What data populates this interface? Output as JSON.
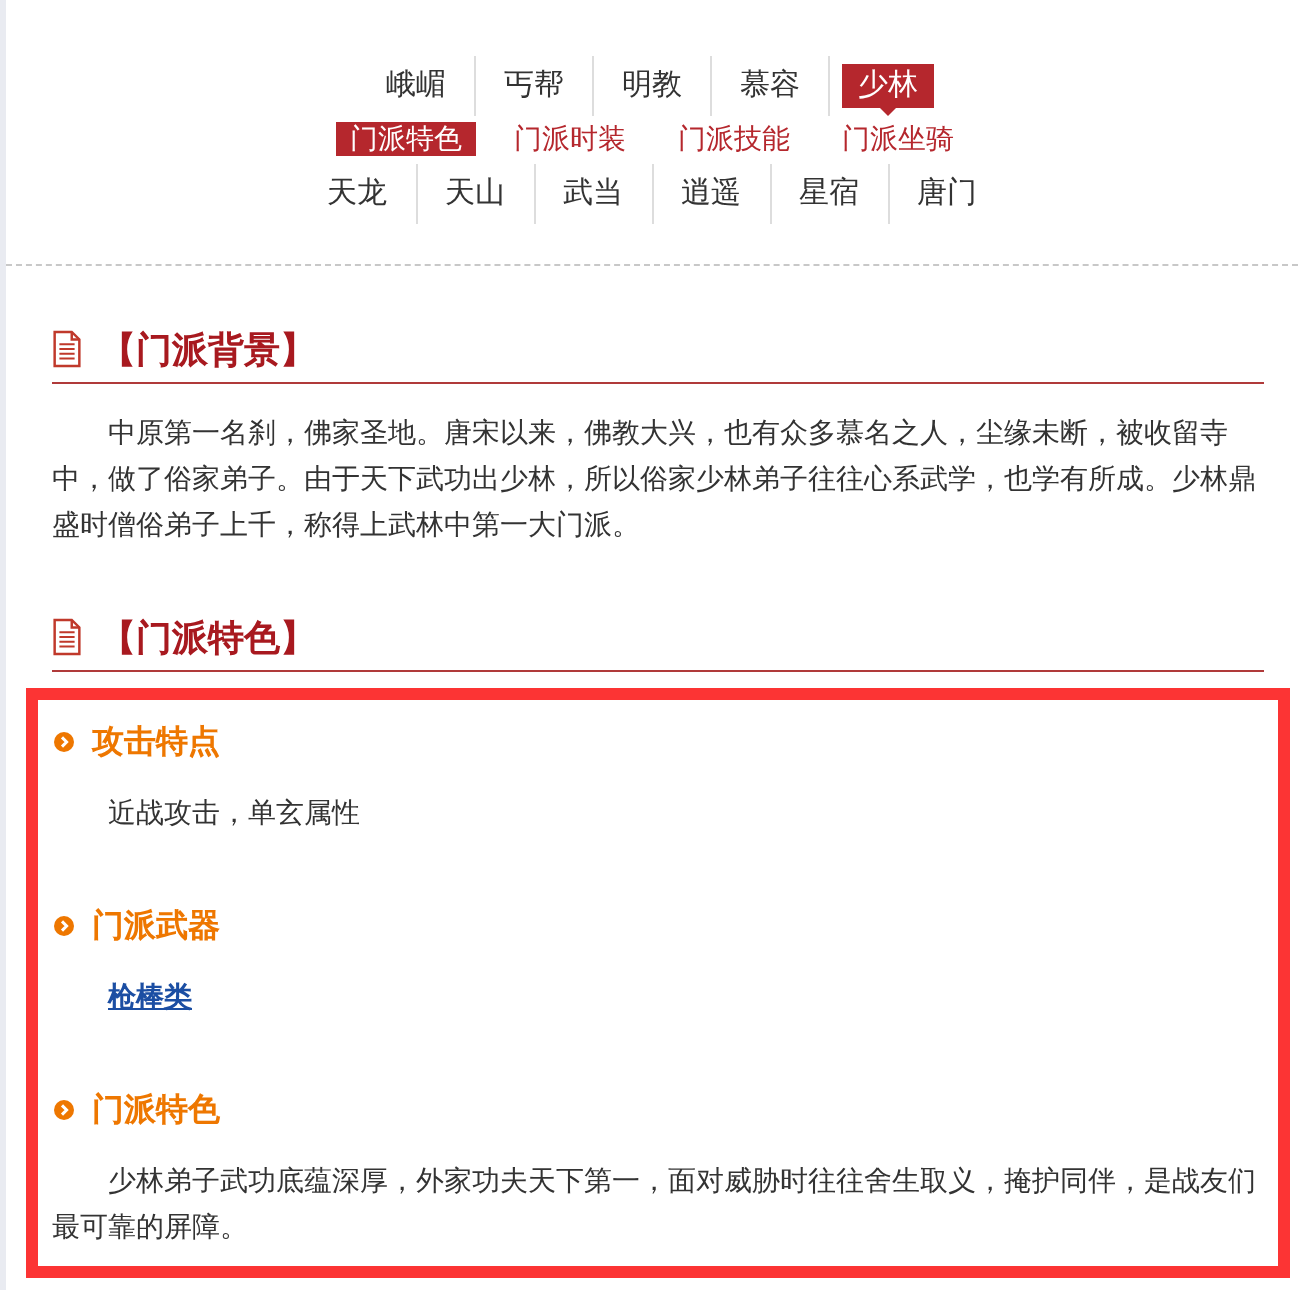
{
  "faction_tabs_top": [
    {
      "label": "峨嵋",
      "selected": false
    },
    {
      "label": "丐帮",
      "selected": false
    },
    {
      "label": "明教",
      "selected": false
    },
    {
      "label": "慕容",
      "selected": false
    },
    {
      "label": "少林",
      "selected": true
    }
  ],
  "sub_tabs": [
    {
      "label": "门派特色",
      "selected": true
    },
    {
      "label": "门派时装",
      "selected": false
    },
    {
      "label": "门派技能",
      "selected": false
    },
    {
      "label": "门派坐骑",
      "selected": false
    }
  ],
  "faction_tabs_bottom": [
    {
      "label": "天龙",
      "selected": false
    },
    {
      "label": "天山",
      "selected": false
    },
    {
      "label": "武当",
      "selected": false
    },
    {
      "label": "逍遥",
      "selected": false
    },
    {
      "label": "星宿",
      "selected": false
    },
    {
      "label": "唐门",
      "selected": false
    }
  ],
  "sections": [
    {
      "title": "【门派背景】",
      "paragraph": "中原第一名刹，佛家圣地。唐宋以来，佛教大兴，也有众多慕名之人，尘缘未断，被收留寺中，做了俗家弟子。由于天下武功出少林，所以俗家少林弟子往往心系武学，也学有所成。少林鼎盛时僧俗弟子上千，称得上武林中第一大门派。"
    },
    {
      "title": "【门派特色】",
      "highlighted": true,
      "items": [
        {
          "title": "攻击特点",
          "kind": "text",
          "text": "近战攻击，单玄属性"
        },
        {
          "title": "门派武器",
          "kind": "link",
          "text": "枪棒类"
        },
        {
          "title": "门派特色",
          "kind": "text",
          "text": "少林弟子武功底蕴深厚，外家功夫天下第一，面对威胁时往往舍生取义，掩护同伴，是战友们最可靠的屏障。"
        }
      ]
    }
  ]
}
